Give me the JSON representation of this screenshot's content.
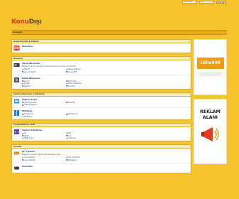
{
  "login": {
    "username_placeholder": "Kullanıcı Adı",
    "password_placeholder": "Şifre",
    "submit_label": "Giriş Yap"
  },
  "logo": {
    "part1": "Konu",
    "part2": "Dışı"
  },
  "nav": {
    "forum_label": "Anasayfa"
  },
  "categories": [
    {
      "title": "Genel Konular & Sohbet",
      "forums": [
        {
          "icon": "forum-logo-icon",
          "title": "Konu Dışı",
          "desc": "",
          "subs": [],
          "stats": ""
        }
      ]
    },
    {
      "title": "Donanım",
      "forums": [
        {
          "icon": "ssd-icon",
          "title": "Harici Bileşenler",
          "desc": "Bilgisayar ve ağ donanımları hakkında konular, sorunlar ve çözümler.",
          "subs": [
            "Monitör",
            "Klavye & Mouse",
            "Yazıcı & Tarayıcı",
            "Kasa & PSU"
          ],
          "stats": ""
        },
        {
          "icon": "hdd-icon",
          "title": "Dahili Bileşenler",
          "desc": "",
          "subs": [
            "İşlemci",
            "Ekran Kartı",
            "Anakart",
            "RAM & Depolama",
            "Soğutma",
            "Ses Kartı"
          ],
          "stats": ""
        }
      ]
    },
    {
      "title": "İşletim Sistemleri & Yazılımlar",
      "forums": [
        {
          "icon": "software-icon",
          "title": "Yazılım Genel",
          "desc": "",
          "subs": [
            "Ofis Programları",
            "Güvenlik",
            "Grafik & Tasarım"
          ],
          "stats": ""
        },
        {
          "icon": "windows-icon",
          "title": "Windows",
          "desc": "",
          "subs": [
            "Windows 10",
            "Windows 11",
            "Windows 7"
          ],
          "stats": ""
        }
      ]
    },
    {
      "title": "Programlama & Web",
      "forums": [
        {
          "icon": "code-icon",
          "title": "Yazılım Geliştirme",
          "desc": "",
          "subs": [
            "C#",
            "PHP",
            "Python",
            "Java",
            "HTML & CSS",
            "JavaScript"
          ],
          "stats": ""
        }
      ]
    },
    {
      "title": "Oyunlar",
      "forums": [
        {
          "icon": "game-icon",
          "title": "PC Oyunları",
          "desc": "Bilgisayar oyunları hakkında genel paylaşım alanı.",
          "subs": [
            "Oyun Önerileri",
            "Oyun Sorunları",
            "Oyun Haberleri",
            "Multiplayer"
          ],
          "stats": ""
        },
        {
          "icon": "console-icon",
          "title": "Konsollar",
          "desc": "",
          "subs": [],
          "stats": ""
        }
      ]
    }
  ],
  "ads": {
    "ad1_size": "160x600",
    "ad2_line1": "REKLAM",
    "ad2_line2": "ALANI"
  },
  "colors": {
    "background": "#f6c32f",
    "accent": "#e23a1e",
    "link": "#1d3f6b"
  }
}
